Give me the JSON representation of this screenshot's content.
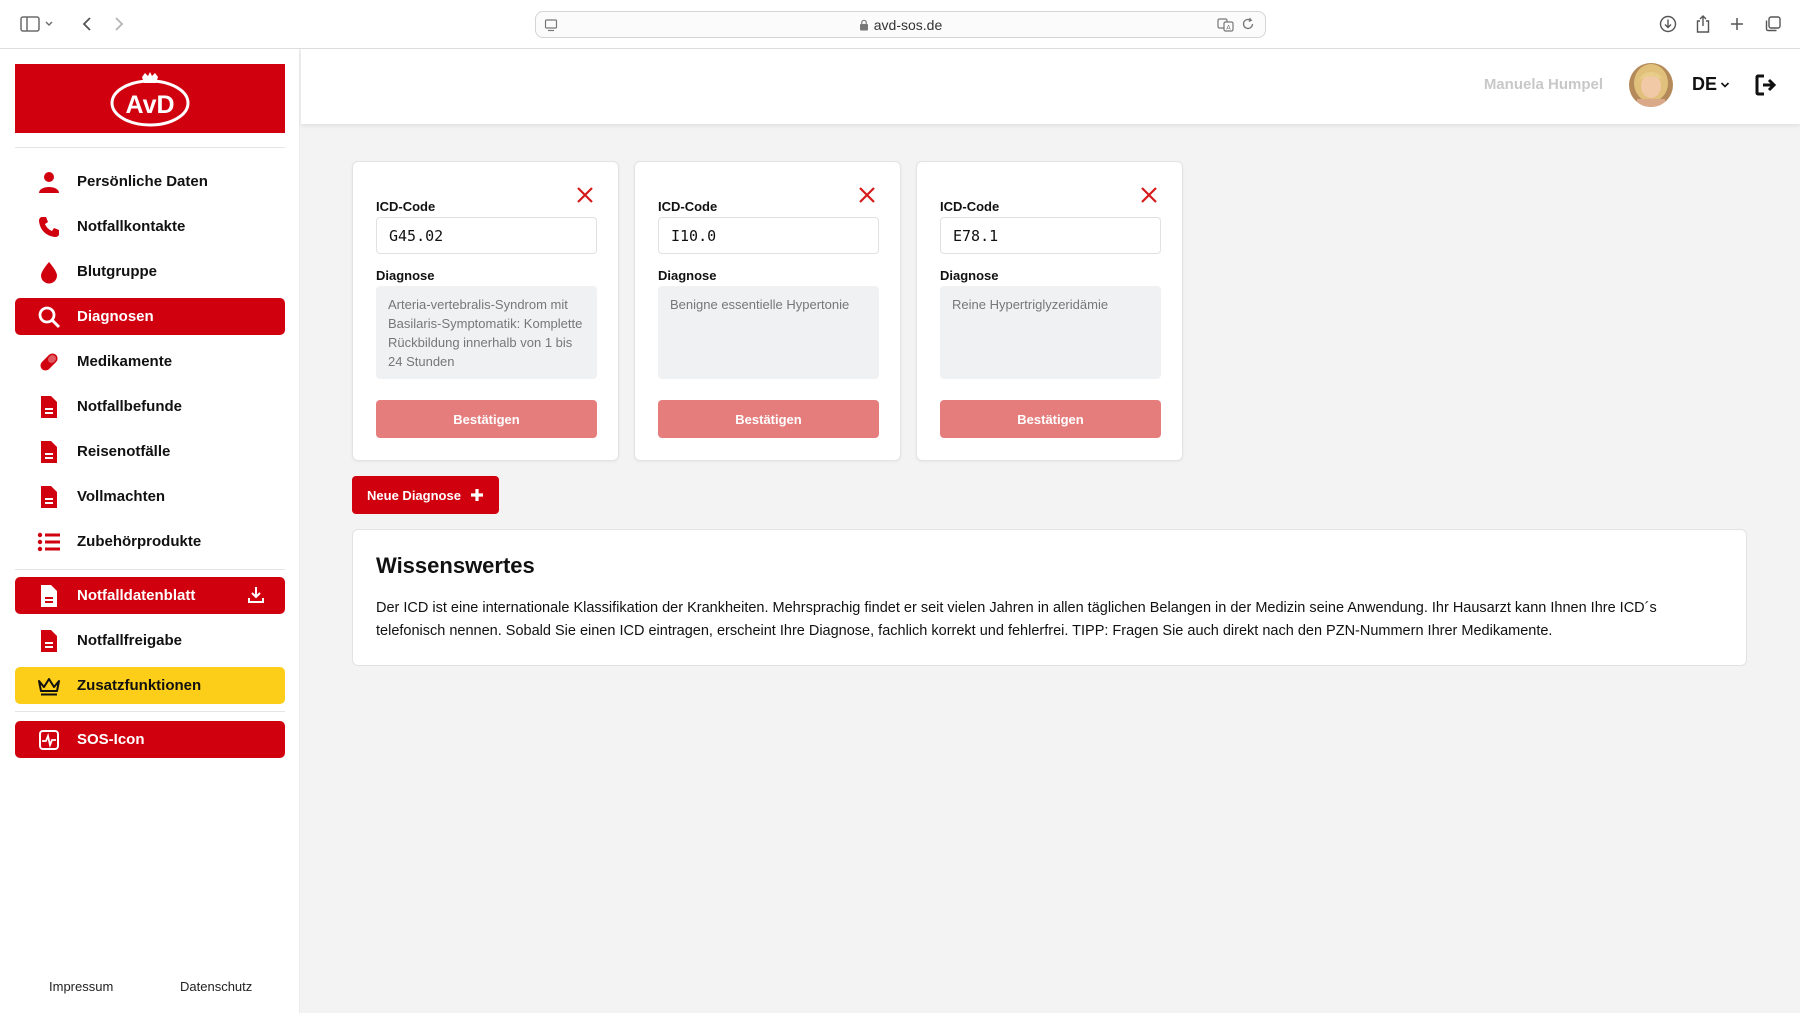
{
  "browser": {
    "url": "avd-sos.de"
  },
  "sidebar": {
    "logo_text": "AvD",
    "items": [
      {
        "label": "Persönliche Daten",
        "icon": "person-icon"
      },
      {
        "label": "Notfallkontakte",
        "icon": "phone-icon"
      },
      {
        "label": "Blutgruppe",
        "icon": "blood-drop-icon"
      },
      {
        "label": "Diagnosen",
        "icon": "search-icon",
        "active": true
      },
      {
        "label": "Medikamente",
        "icon": "pill-icon"
      },
      {
        "label": "Notfallbefunde",
        "icon": "document-icon"
      },
      {
        "label": "Reisenotfälle",
        "icon": "document-icon"
      },
      {
        "label": "Vollmachten",
        "icon": "document-icon"
      },
      {
        "label": "Zubehörprodukte",
        "icon": "list-icon"
      }
    ],
    "extra_items": [
      {
        "label": "Notfalldatenblatt",
        "icon": "document-icon",
        "right_icon": "download-icon"
      },
      {
        "label": "Notfallfreigabe",
        "icon": "document-icon"
      },
      {
        "label": "Zusatzfunktionen",
        "icon": "crown-icon"
      },
      {
        "label": "SOS-Icon",
        "icon": "pulse-icon"
      }
    ],
    "footer": {
      "impressum": "Impressum",
      "datenschutz": "Datenschutz"
    }
  },
  "header": {
    "user_name": "Manuela Humpel",
    "language": "DE"
  },
  "diagnoses": [
    {
      "code_label": "ICD-Code",
      "code": "G45.02",
      "diag_label": "Diagnose",
      "diagnosis": "Arteria-vertebralis-Syndrom mit Basilaris-Symptomatik: Komplette Rückbildung innerhalb von 1 bis 24 Stunden",
      "confirm": "Bestätigen"
    },
    {
      "code_label": "ICD-Code",
      "code": "I10.0",
      "diag_label": "Diagnose",
      "diagnosis": "Benigne essentielle Hypertonie",
      "confirm": "Bestätigen"
    },
    {
      "code_label": "ICD-Code",
      "code": "E78.1",
      "diag_label": "Diagnose",
      "diagnosis": "Reine Hypertriglyzeridämie",
      "confirm": "Bestätigen"
    }
  ],
  "new_diagnosis_label": "Neue Diagnose",
  "info": {
    "title": "Wissenswertes",
    "text": "Der ICD ist eine internationale Klassifikation der Krankheiten. Mehrsprachig findet er seit vielen Jahren in allen täglichen Belangen in der Medizin seine Anwendung. Ihr Hausarzt kann Ihnen Ihre ICD´s telefonisch nennen. Sobald Sie einen ICD eintragen, erscheint Ihre Diagnose, fachlich korrekt und fehlerfrei. TIPP: Fragen Sie auch direkt nach den PZN-Nummern Ihrer Medikamente."
  },
  "colors": {
    "brand_red": "#d0000f",
    "confirm_disabled": "#e67d7d",
    "premium_gold": "#fcce19"
  }
}
